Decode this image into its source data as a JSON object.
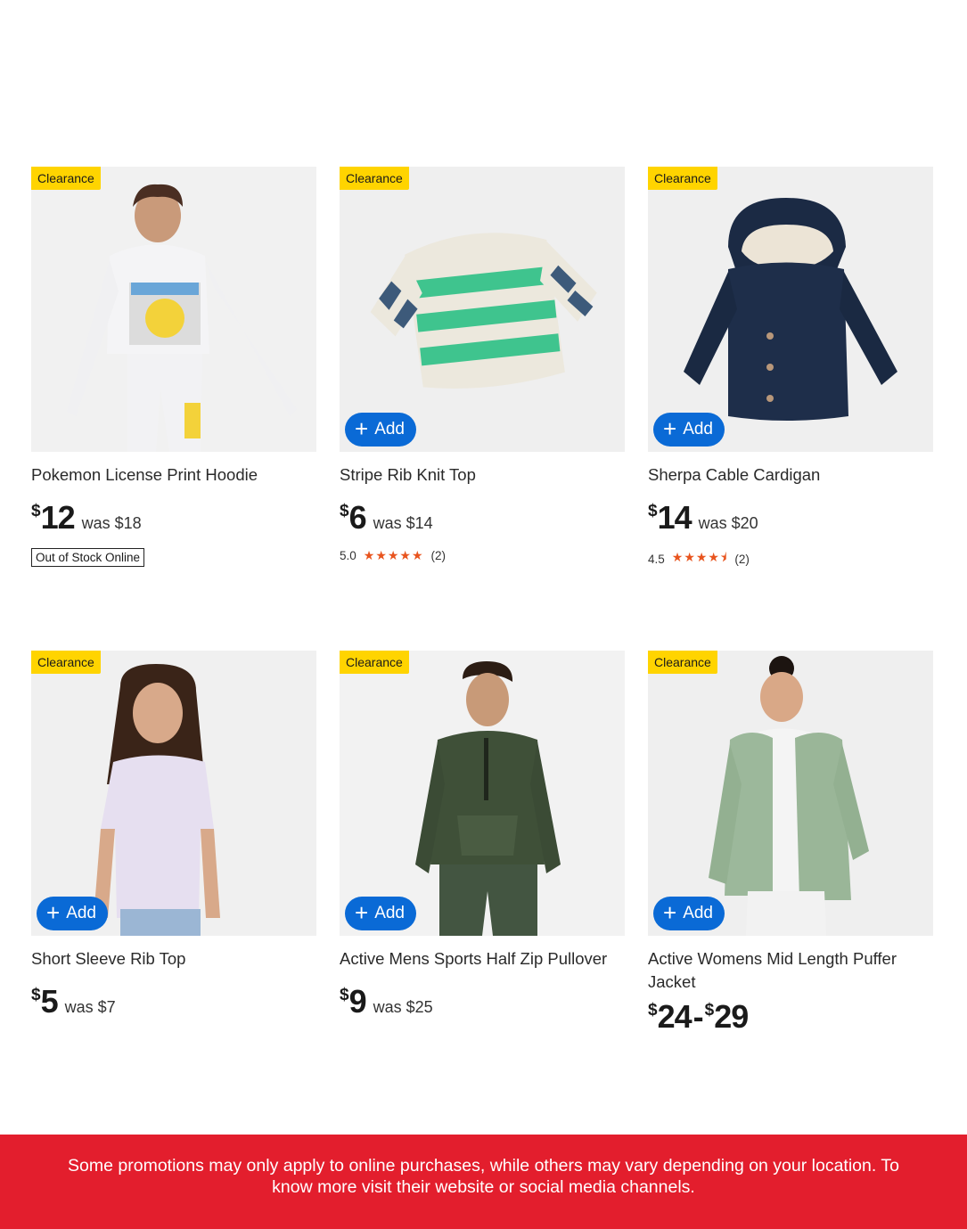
{
  "products": [
    {
      "badge": "Clearance",
      "title": "Pokemon License Print Hoodie",
      "currency": "$",
      "price": "12",
      "was": "was $18",
      "stock_label": "Out of Stock Online",
      "image": "boy-pikachu-hoodie"
    },
    {
      "badge": "Clearance",
      "title": "Stripe Rib Knit Top",
      "currency": "$",
      "price": "6",
      "was": "was $14",
      "add_label": "Add",
      "rating": "5.0",
      "stars": "★★★★★",
      "reviews": "(2)",
      "image": "striped-sweater"
    },
    {
      "badge": "Clearance",
      "title": "Sherpa Cable Cardigan",
      "currency": "$",
      "price": "14",
      "was": "was $20",
      "add_label": "Add",
      "rating": "4.5",
      "stars": "★★★★⯨",
      "reviews": "(2)",
      "image": "navy-hooded-cardigan"
    },
    {
      "badge": "Clearance",
      "title": "Short Sleeve Rib Top",
      "currency": "$",
      "price": "5",
      "was": "was $7",
      "add_label": "Add",
      "image": "girl-lilac-tee"
    },
    {
      "badge": "Clearance",
      "title": "Active Mens Sports Half Zip Pullover",
      "currency": "$",
      "price": "9",
      "was": "was $25",
      "add_label": "Add",
      "image": "man-green-pullover"
    },
    {
      "badge": "Clearance",
      "title": "Active Womens Mid Length Puffer Jacket",
      "currency_1": "$",
      "price_low": "24",
      "range_dash": "-",
      "currency_2": "$",
      "price_high": "29",
      "add_label": "Add",
      "image": "woman-sage-puffer"
    }
  ],
  "banner": {
    "text": "Some promotions may only apply to online purchases, while others may vary depending on your location. To know more visit their website or social media channels."
  },
  "colors": {
    "badge": "#ffd400",
    "add_button": "#0a6ad6",
    "stars": "#e8541e",
    "banner": "#e31e2d"
  }
}
